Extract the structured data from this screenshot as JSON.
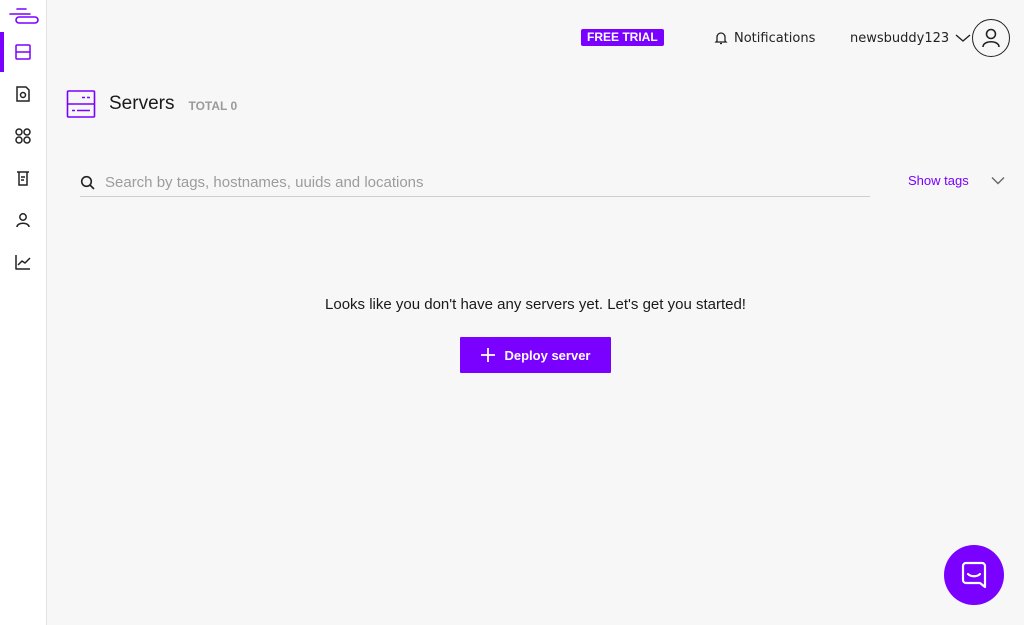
{
  "header": {
    "trial_badge": "FREE TRIAL",
    "notifications_label": "Notifications",
    "username": "newsbuddy123"
  },
  "sidebar": {
    "items": [
      {
        "icon": "servers-icon",
        "active": true
      },
      {
        "icon": "storage-icon",
        "active": false
      },
      {
        "icon": "apps-icon",
        "active": false
      },
      {
        "icon": "billing-icon",
        "active": false
      },
      {
        "icon": "account-icon",
        "active": false
      },
      {
        "icon": "analytics-icon",
        "active": false
      }
    ]
  },
  "page": {
    "title": "Servers",
    "total_label": "TOTAL 0"
  },
  "search": {
    "placeholder": "Search by tags, hostnames, uuids and locations",
    "value": "",
    "show_tags_label": "Show tags"
  },
  "empty_state": {
    "message": "Looks like you don't have any servers yet. Let's get you started!",
    "deploy_label": "Deploy server"
  },
  "colors": {
    "accent": "#7a00ff",
    "background": "#f7f7f7"
  }
}
